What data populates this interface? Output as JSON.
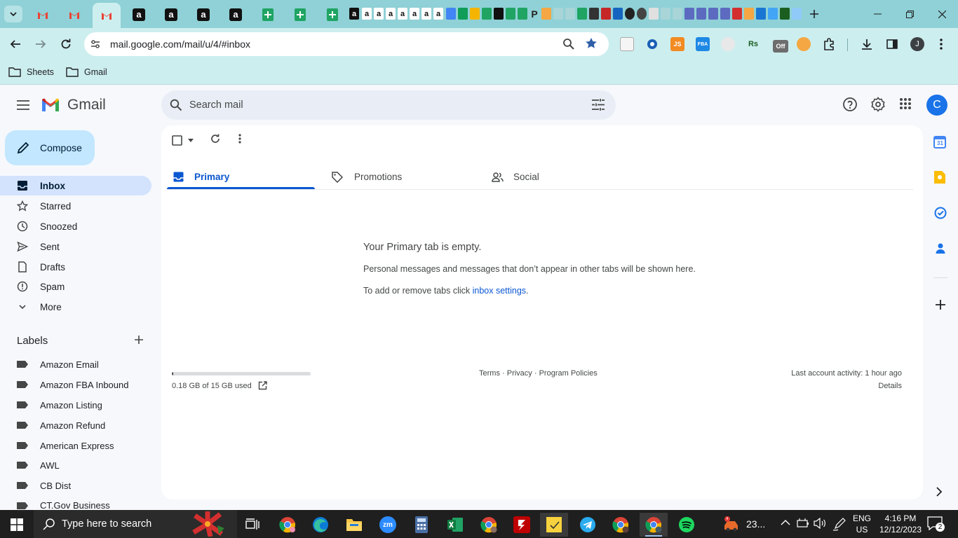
{
  "browser": {
    "url": "mail.google.com/mail/u/4/#inbox",
    "bookmarks": [
      {
        "label": "Sheets"
      },
      {
        "label": "Gmail"
      }
    ],
    "profile_initial": "J",
    "ext_js_label": "JS",
    "ext_fba_label": "FBA",
    "ext_rs_label": "Rs",
    "ext_off_label": "Off"
  },
  "gmail": {
    "brand": "Gmail",
    "search_placeholder": "Search mail",
    "avatar_initial": "C",
    "compose_label": "Compose",
    "nav": [
      {
        "label": "Inbox",
        "icon": "inbox-icon",
        "active": true
      },
      {
        "label": "Starred",
        "icon": "star-icon"
      },
      {
        "label": "Snoozed",
        "icon": "clock-icon"
      },
      {
        "label": "Sent",
        "icon": "send-icon"
      },
      {
        "label": "Drafts",
        "icon": "draft-icon"
      },
      {
        "label": "Spam",
        "icon": "spam-icon"
      },
      {
        "label": "More",
        "icon": "chevron-down-icon"
      }
    ],
    "labels_heading": "Labels",
    "labels": [
      {
        "label": "Amazon Email"
      },
      {
        "label": "Amazon FBA Inbound"
      },
      {
        "label": "Amazon Listing"
      },
      {
        "label": "Amazon Refund"
      },
      {
        "label": "American Express"
      },
      {
        "label": "AWL"
      },
      {
        "label": "CB Dist"
      },
      {
        "label": "CT.Gov Business"
      }
    ],
    "tabs": [
      {
        "label": "Primary",
        "active": true
      },
      {
        "label": "Promotions"
      },
      {
        "label": "Social"
      }
    ],
    "empty": {
      "title": "Your Primary tab is empty.",
      "line1": "Personal messages and messages that don’t appear in other tabs will be shown here.",
      "line2_prefix": "To add or remove tabs click ",
      "line2_link": "inbox settings",
      "line2_suffix": "."
    },
    "footer": {
      "storage_used_fraction": 0.012,
      "storage_text": "0.18 GB of 15 GB used",
      "terms": "Terms",
      "sep1": " · ",
      "privacy": "Privacy",
      "sep2": " · ",
      "policies": "Program Policies",
      "activity": "Last account activity: 1 hour ago",
      "details": "Details"
    },
    "calendar_day": "31"
  },
  "taskbar": {
    "search_placeholder": "Type here to search",
    "weather": "23...",
    "lang1": "ENG",
    "lang2": "US",
    "time": "4:16 PM",
    "date": "12/12/2023",
    "notifications": "2",
    "zoom_label": "zm"
  },
  "colors": {
    "gmail_blue": "#0b57d0",
    "compose_bg": "#c2e7ff",
    "active_nav": "#d3e3fd",
    "tabbar": "#8fd1d6",
    "toolbar": "#cdeeef"
  }
}
